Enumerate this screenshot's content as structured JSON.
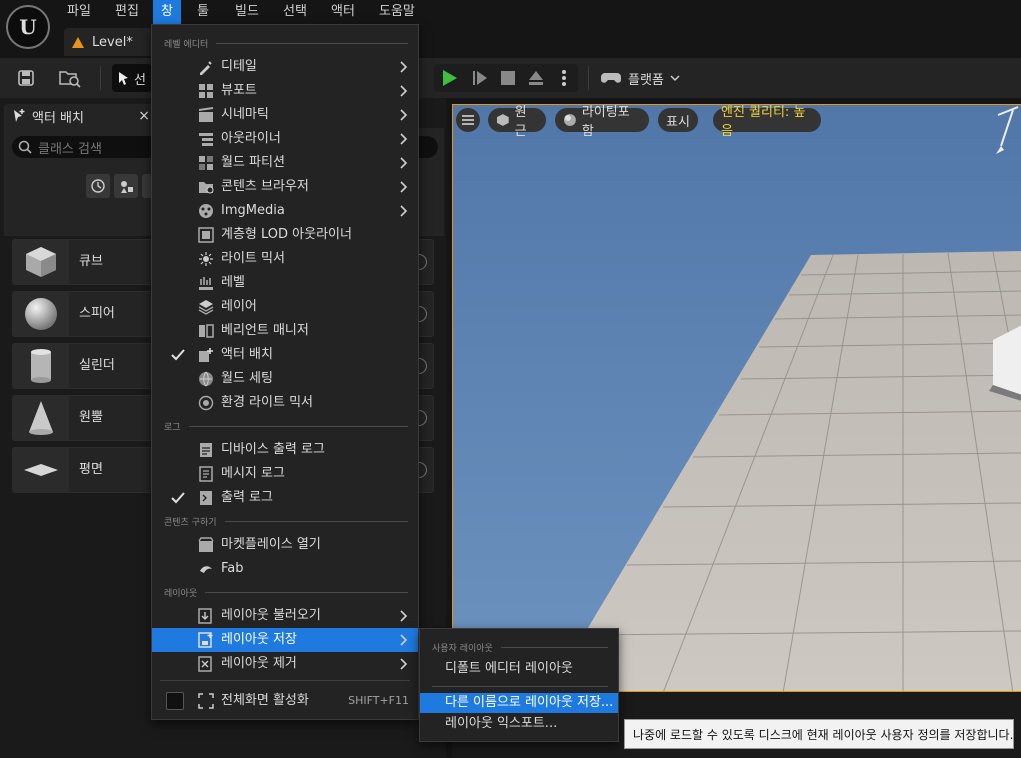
{
  "menubar": {
    "items": [
      "파일",
      "편집",
      "창",
      "툴",
      "빌드",
      "선택",
      "액터",
      "도움말"
    ],
    "active_index": 2,
    "level_tab": "Level*"
  },
  "toolbar": {
    "select_label": "선",
    "platform_label": "플랫폼",
    "icons": [
      "save-icon",
      "content-browser-icon",
      "select-mode-icon",
      "play-icon",
      "step-icon",
      "stop-icon",
      "eject-icon",
      "more-icon",
      "gamepad-icon"
    ]
  },
  "panel": {
    "title": "액터 배치",
    "close": "×",
    "search_placeholder": "클래스 검색",
    "actors": [
      {
        "label": "큐브",
        "thumb": "cube-icon"
      },
      {
        "label": "스피어",
        "thumb": "sphere-icon"
      },
      {
        "label": "실린더",
        "thumb": "cylinder-icon"
      },
      {
        "label": "원뿔",
        "thumb": "cone-icon"
      },
      {
        "label": "평면",
        "thumb": "plane-icon"
      }
    ]
  },
  "viewport": {
    "menu_icon": "hamburger-icon",
    "perspective": "원근",
    "lighting": "라이팅포함",
    "show": "표시",
    "quality": "엔진 퀄리티: 높음"
  },
  "dropdown": {
    "sections": {
      "level_editor": "레벨 에디터",
      "log": "로그",
      "content": "콘텐츠 구하기",
      "layout": "레이아웃"
    },
    "items": [
      {
        "label": "디테일",
        "icon": "details-icon",
        "submenu": true,
        "checked": false
      },
      {
        "label": "뷰포트",
        "icon": "viewport-icon",
        "submenu": true,
        "checked": false
      },
      {
        "label": "시네마틱",
        "icon": "cinematics-icon",
        "submenu": true,
        "checked": false
      },
      {
        "label": "아웃라이너",
        "icon": "outliner-icon",
        "submenu": true,
        "checked": false
      },
      {
        "label": "월드 파티션",
        "icon": "world-partition-icon",
        "submenu": true,
        "checked": false
      },
      {
        "label": "콘텐츠 브라우저",
        "icon": "content-browser-icon",
        "submenu": true,
        "checked": false
      },
      {
        "label": "ImgMedia",
        "icon": "imgmedia-icon",
        "submenu": true,
        "checked": false
      },
      {
        "label": "계층형 LOD 아웃라이너",
        "icon": "hlod-icon",
        "submenu": false,
        "checked": false
      },
      {
        "label": "라이트 믹서",
        "icon": "light-mixer-icon",
        "submenu": false,
        "checked": false
      },
      {
        "label": "레벨",
        "icon": "levels-icon",
        "submenu": false,
        "checked": false
      },
      {
        "label": "레이어",
        "icon": "layers-icon",
        "submenu": false,
        "checked": false
      },
      {
        "label": "베리언트 매니저",
        "icon": "variant-manager-icon",
        "submenu": false,
        "checked": false
      },
      {
        "label": "액터 배치",
        "icon": "place-actors-icon",
        "submenu": false,
        "checked": true
      },
      {
        "label": "월드 세팅",
        "icon": "world-settings-icon",
        "submenu": false,
        "checked": false
      },
      {
        "label": "환경 라이트 믹서",
        "icon": "env-light-mixer-icon",
        "submenu": false,
        "checked": false
      }
    ],
    "log_items": [
      {
        "label": "디바이스 출력 로그",
        "icon": "device-log-icon",
        "checked": false
      },
      {
        "label": "메시지 로그",
        "icon": "message-log-icon",
        "checked": false
      },
      {
        "label": "출력 로그",
        "icon": "output-log-icon",
        "checked": true
      }
    ],
    "content_items": [
      {
        "label": "마켓플레이스 열기",
        "icon": "marketplace-icon"
      },
      {
        "label": "Fab",
        "icon": "fab-icon"
      }
    ],
    "layout_items": [
      {
        "label": "레이아웃 불러오기",
        "icon": "load-layout-icon",
        "submenu": true
      },
      {
        "label": "레이아웃 저장",
        "icon": "save-layout-icon",
        "submenu": true,
        "highlight": true
      },
      {
        "label": "레이아웃 제거",
        "icon": "remove-layout-icon",
        "submenu": true
      }
    ],
    "fullscreen": {
      "label": "전체화면 활성화",
      "shortcut": "SHIFT+F11"
    }
  },
  "submenu": {
    "header": "사용자 레이아웃",
    "default_layout": "디폴트 에디터 레이아웃",
    "save_as": "다른 이름으로 레이아웃 저장...",
    "export": "레이아웃 익스포트..."
  },
  "tooltip": "나중에 로드할 수 있도록 디스크에 현재 레이아웃 사용자 정의를 저장합니다."
}
